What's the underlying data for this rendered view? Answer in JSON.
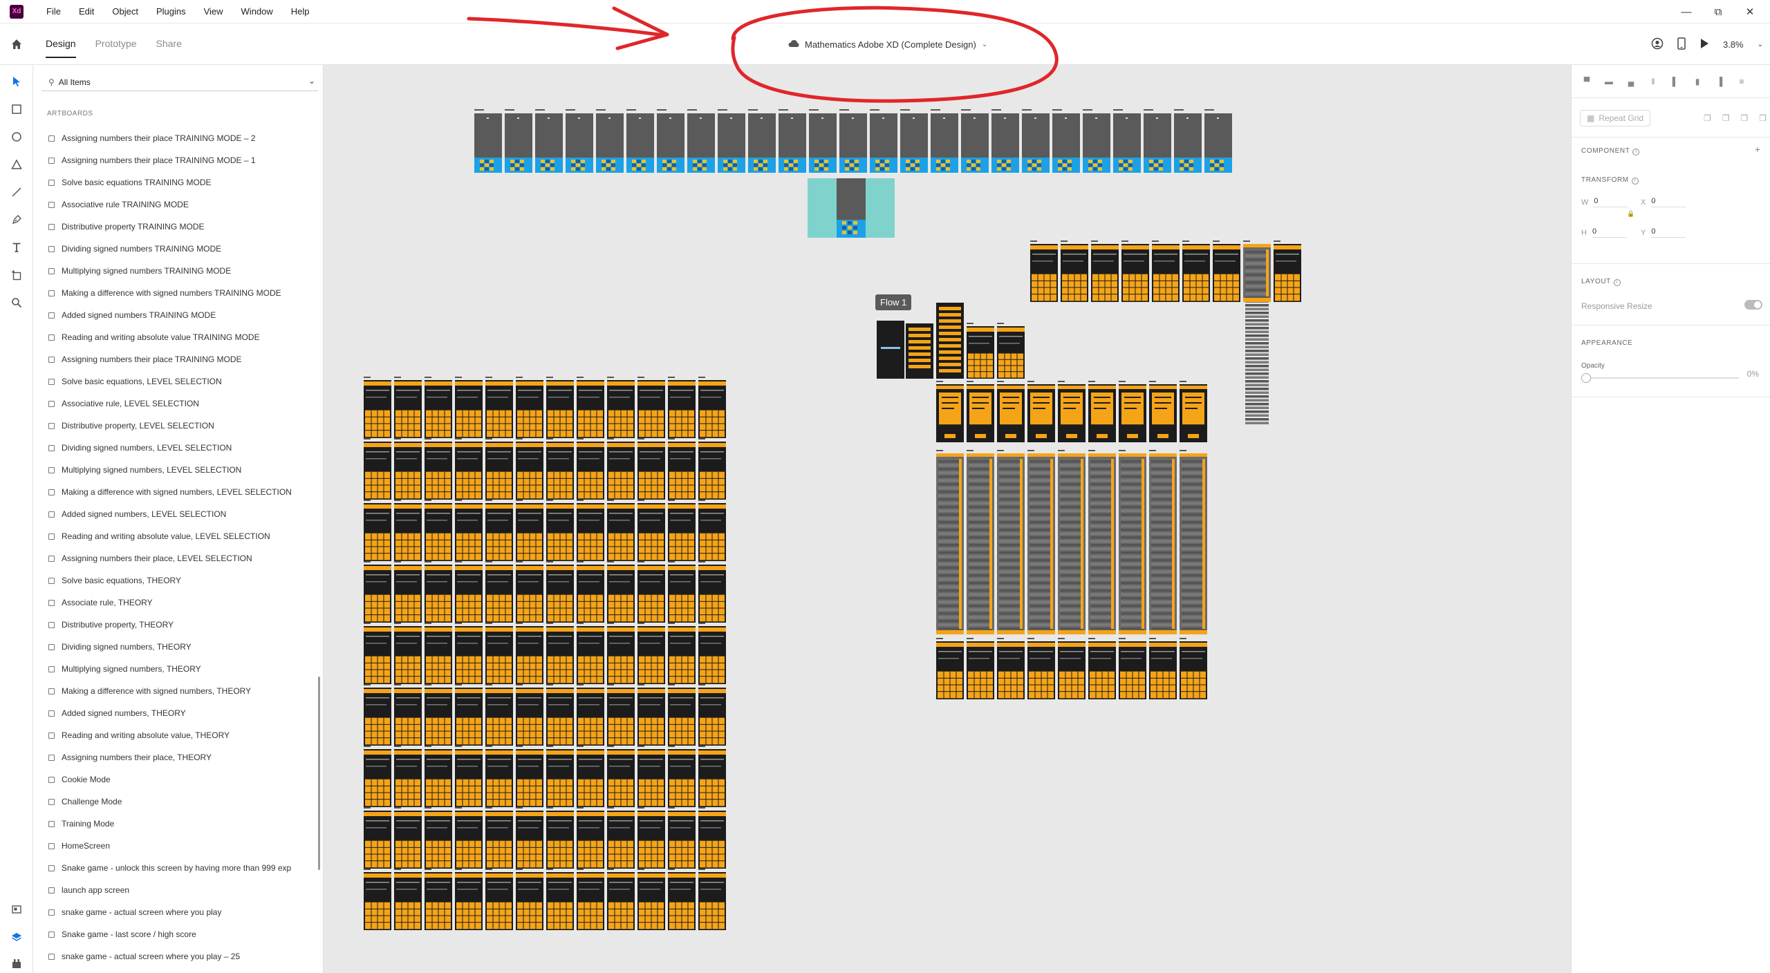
{
  "app": {
    "logo_text": "Xd",
    "menu": [
      "File",
      "Edit",
      "Object",
      "Plugins",
      "View",
      "Window",
      "Help"
    ]
  },
  "toolbar": {
    "tabs": [
      "Design",
      "Prototype",
      "Share"
    ],
    "active_tab": "Design",
    "document_title": "Mathematics Adobe XD (Complete Design)",
    "zoom": "3.8%"
  },
  "layers": {
    "filter": "All Items",
    "heading": "ARTBOARDS",
    "items": [
      "Assigning numbers their place TRAINING MODE – 2",
      "Assigning numbers their place TRAINING MODE – 1",
      "Solve basic equations TRAINING MODE",
      "Associative rule TRAINING MODE",
      "Distributive property TRAINING MODE",
      "Dividing signed numbers TRAINING MODE",
      "Multiplying signed numbers TRAINING MODE",
      "Making a difference with signed numbers TRAINING MODE",
      "Added signed numbers TRAINING MODE",
      "Reading and writing absolute value TRAINING MODE",
      "Assigning numbers their place TRAINING MODE",
      "Solve basic equations, LEVEL SELECTION",
      "Associative rule, LEVEL SELECTION",
      "Distributive property, LEVEL SELECTION",
      "Dividing signed numbers, LEVEL SELECTION",
      "Multiplying signed numbers, LEVEL SELECTION",
      "Making a difference with signed numbers, LEVEL SELECTION",
      "Added signed numbers, LEVEL SELECTION",
      "Reading and writing absolute value, LEVEL SELECTION",
      "Assigning numbers their place, LEVEL SELECTION",
      "Solve basic equations, THEORY",
      "Associate rule, THEORY",
      "Distributive property, THEORY",
      "Dividing signed numbers, THEORY",
      "Multiplying signed numbers, THEORY",
      "Making a difference with signed numbers, THEORY",
      "Added signed numbers, THEORY",
      "Reading and writing absolute value, THEORY",
      "Assigning numbers their place, THEORY",
      "Cookie Mode",
      "Challenge Mode",
      "Training Mode",
      "HomeScreen",
      "Snake game - unlock this screen by having more than 999 exp",
      "launch app screen",
      "snake game - actual screen where you play",
      "Snake game - last score / high score",
      "snake game - actual screen where you play – 25"
    ]
  },
  "canvas": {
    "flow_label": "Flow 1"
  },
  "inspector": {
    "repeat_grid": "Repeat Grid",
    "component": "COMPONENT",
    "transform": "TRANSFORM",
    "w_label": "W",
    "w_value": "0",
    "x_label": "X",
    "x_value": "0",
    "h_label": "H",
    "h_value": "0",
    "y_label": "Y",
    "y_value": "0",
    "layout": "LAYOUT",
    "responsive_resize": "Responsive Resize",
    "appearance": "APPEARANCE",
    "opacity_label": "Opacity",
    "opacity_value": "0%"
  },
  "colors": {
    "annotation": "#e0262b",
    "artboard_orange": "#f5a418",
    "artboard_dark": "#1c1c1c",
    "artboard_gray": "#5a5a5a",
    "artboard_blue": "#1da1e6",
    "artboard_teal": "#7fd3cc"
  }
}
